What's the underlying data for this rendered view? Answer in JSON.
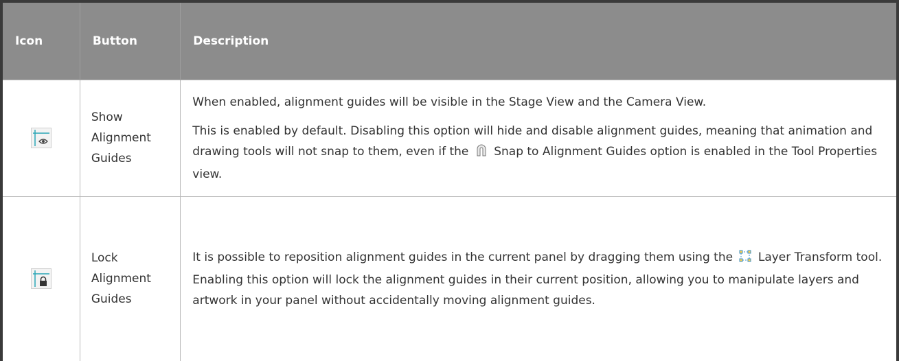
{
  "headers": {
    "icon": "Icon",
    "button": "Button",
    "description": "Description"
  },
  "rows": [
    {
      "icon": "show-alignment-guides-icon",
      "button": "Show Alignment Guides",
      "desc1": "When enabled, alignment guides will be visible in the Stage View and the Camera View.",
      "desc2_before": "This is enabled by default. Disabling this option will hide and disable alignment guides, meaning that animation and drawing tools will not snap to them, even if the",
      "desc2_after": "Snap to Alignment Guides option is enabled in the Tool Properties view."
    },
    {
      "icon": "lock-alignment-guides-icon",
      "button": "Lock Alignment Guides",
      "desc_before": "It is possible to reposition alignment guides in the current panel by dragging them using the",
      "desc_after": "Layer Transform tool. Enabling this option will lock the alignment guides in their current position, allowing you to manipulate layers and artwork in your panel without accidentally moving alignment guides."
    }
  ],
  "colors": {
    "header_bg": "#8c8c8c",
    "border_dark": "#3a3a3a",
    "guide_teal": "#2aa6b6",
    "icon_blue": "#3a8fc9"
  }
}
